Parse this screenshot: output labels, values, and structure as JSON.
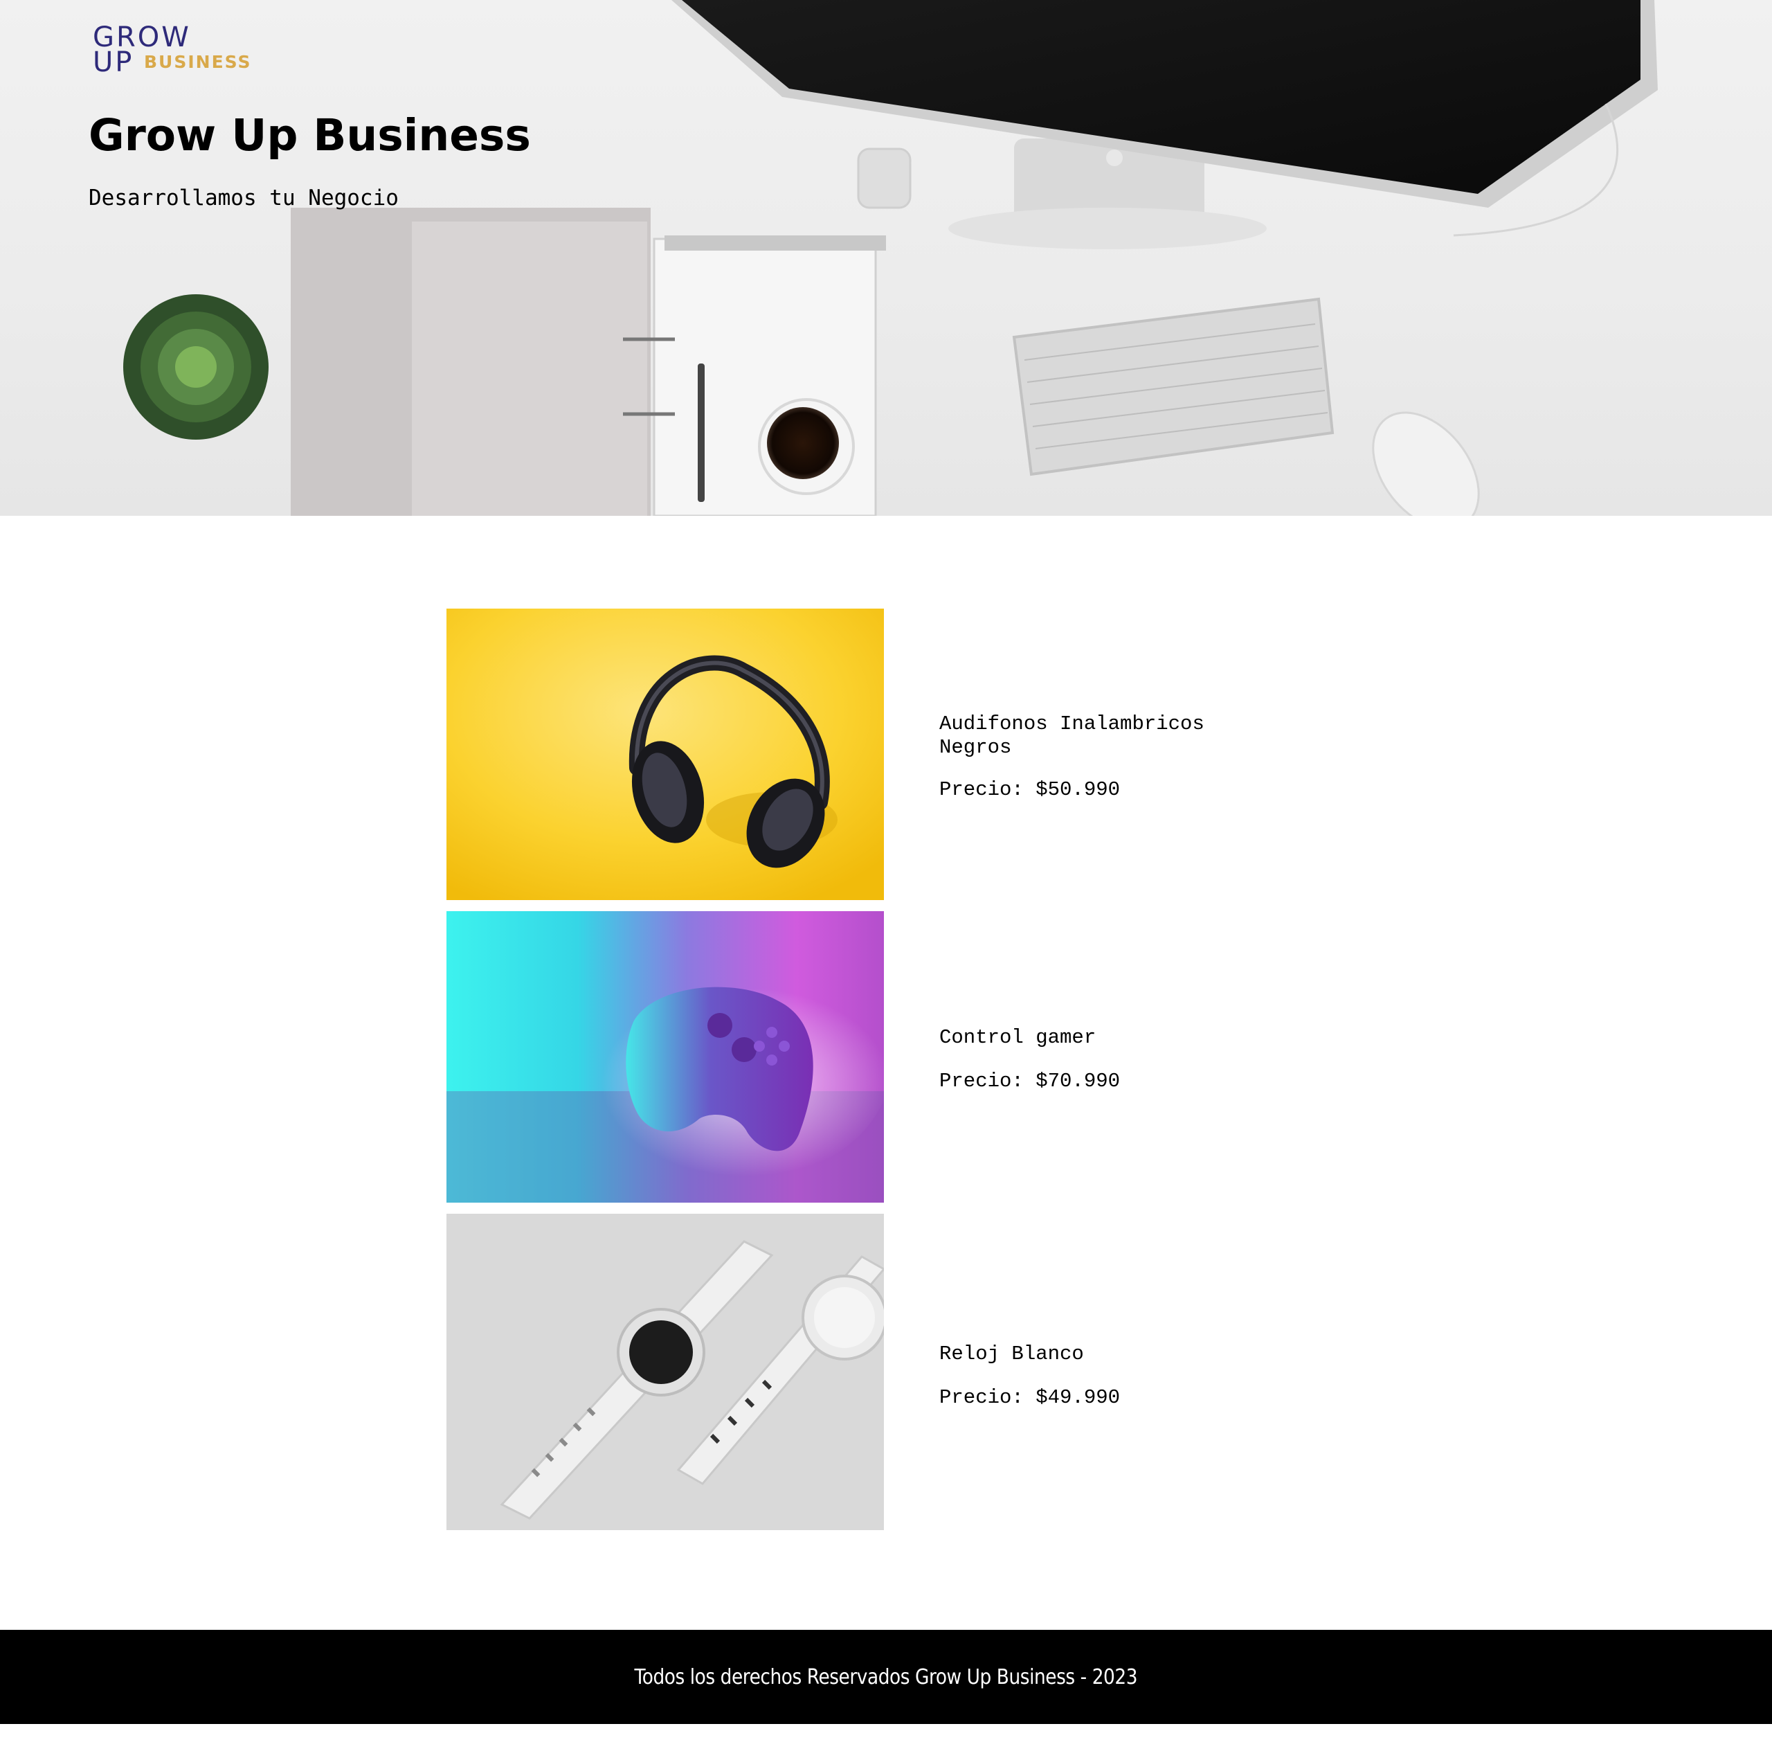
{
  "brand": {
    "logo_line1": "GROW",
    "logo_line2": "UP",
    "logo_sub": "BUSINESS",
    "primary_color": "#2e2a7a",
    "accent_color": "#d9a94a"
  },
  "hero": {
    "title": "Grow Up Business",
    "subtitle": "Desarrollamos tu Negocio",
    "image": "desk-workspace-photo"
  },
  "products": [
    {
      "name": "Audifonos Inalambricos Negros",
      "price": "Precio: $50.990",
      "image": "black-headphones-on-yellow-photo"
    },
    {
      "name": "Control gamer",
      "price": "Precio: $70.990",
      "image": "purple-gamepad-on-neon-photo"
    },
    {
      "name": "Reloj Blanco",
      "price": "Precio: $49.990",
      "image": "white-smartwatches-photo"
    }
  ],
  "footer": {
    "text": "Todos los derechos Reservados Grow Up Business - 2023"
  }
}
